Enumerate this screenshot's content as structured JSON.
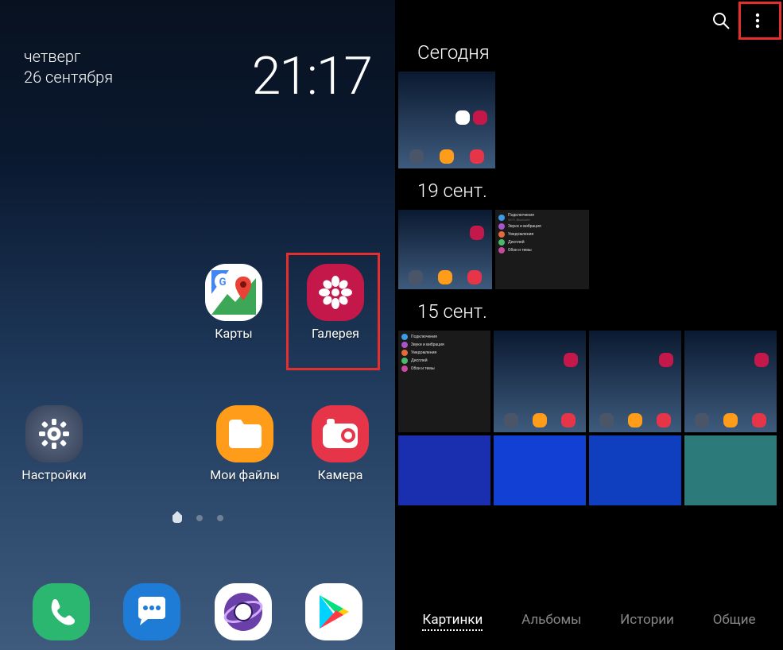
{
  "home": {
    "day": "четверг",
    "date": "26 сентября",
    "time": "21:17",
    "apps": {
      "maps": "Карты",
      "gallery": "Галерея",
      "settings": "Настройки",
      "files": "Мои файлы",
      "camera": "Камера"
    }
  },
  "gallery": {
    "sections": {
      "today": "Сегодня",
      "sept19": "19 сент.",
      "sept15": "15 сент."
    },
    "tabs": {
      "pictures": "Картинки",
      "albums": "Альбомы",
      "stories": "Истории",
      "shared": "Общие"
    },
    "settings_labels": {
      "connections": "Подключения",
      "sound": "Звуки и вибрация",
      "notifications": "Уведомления",
      "display": "Дисплей",
      "wallpaper": "Обои и темы"
    }
  }
}
